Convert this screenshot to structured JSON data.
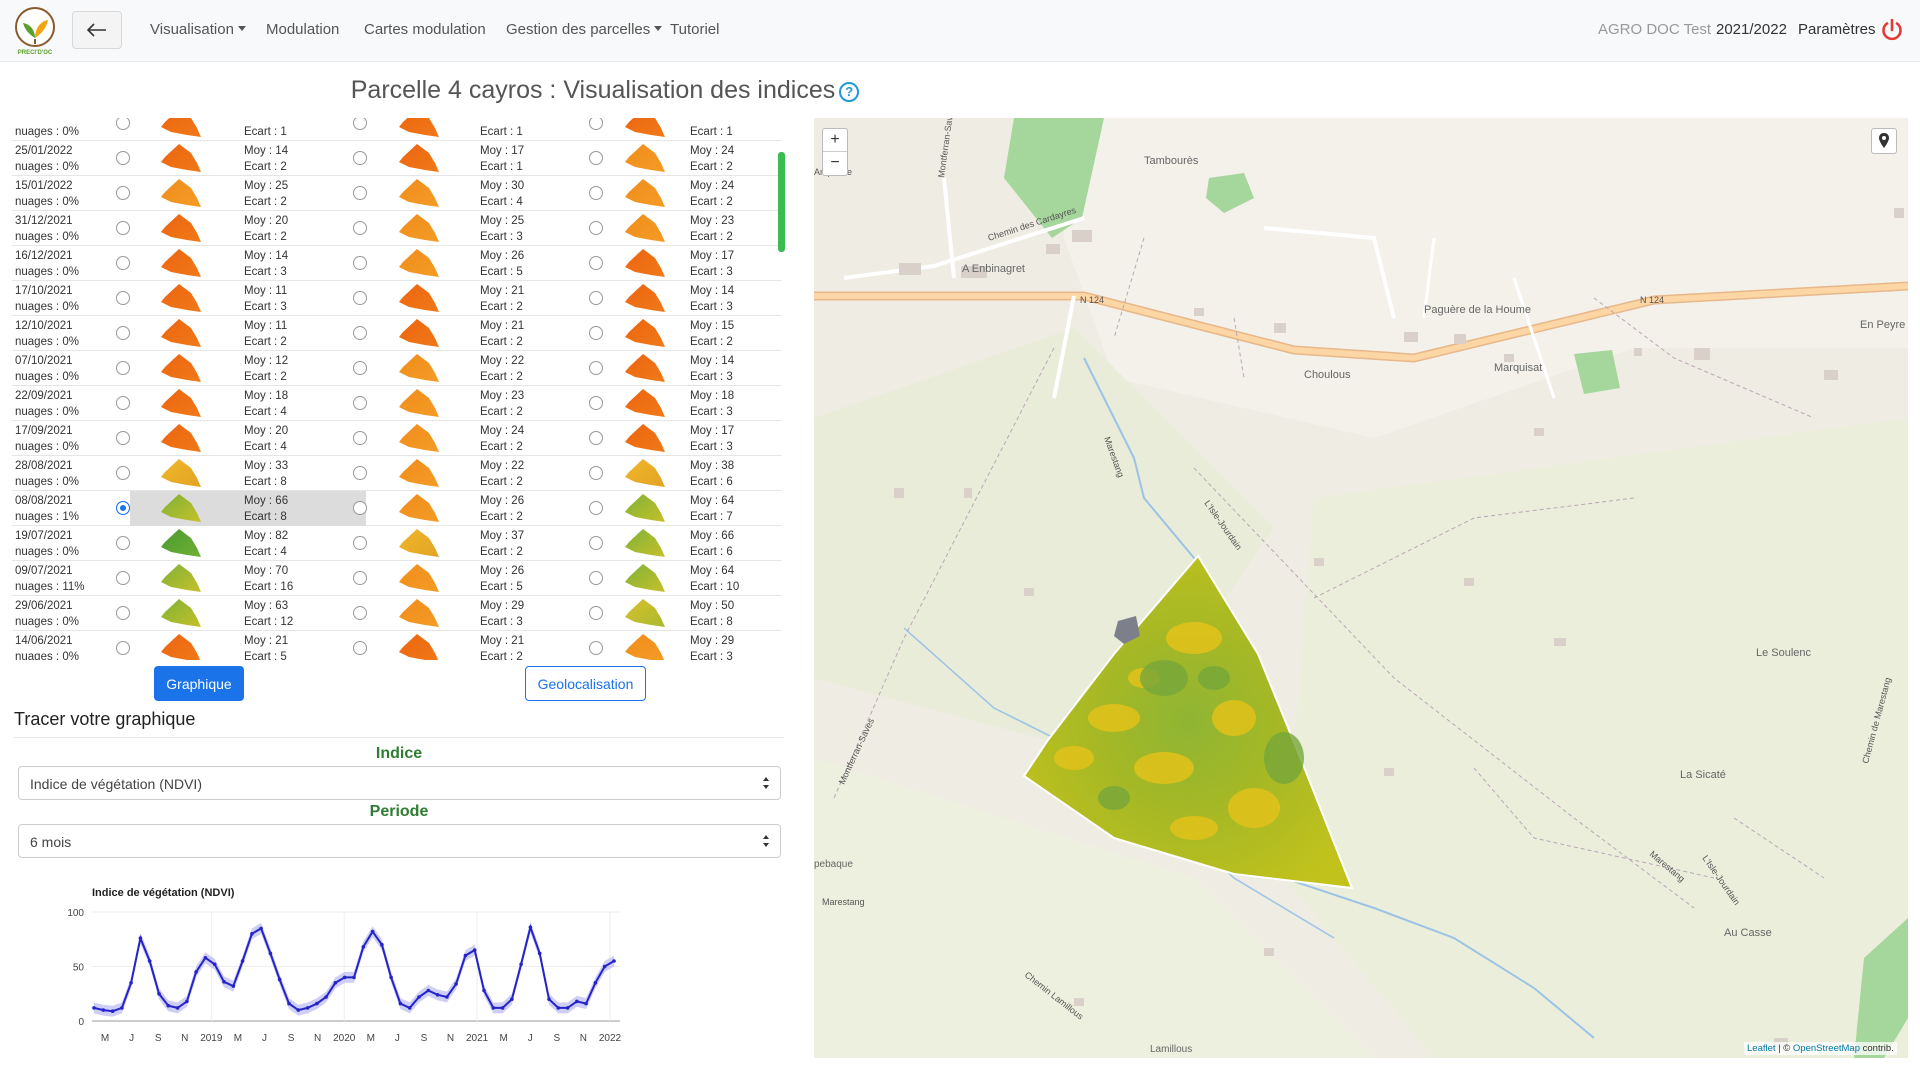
{
  "nav": {
    "logo_text": "PRECI'D'OC",
    "items": [
      "Visualisation",
      "Modulation",
      "Cartes modulation",
      "Gestion des parcelles",
      "Tutoriel"
    ],
    "user": "AGRO DOC Test",
    "season": "2021/2022",
    "settings": "Paramètres"
  },
  "page": {
    "title": "Parcelle 4 cayros : Visualisation des indices"
  },
  "rows": [
    {
      "date": "",
      "clouds": "nuages : 0%",
      "a_moy": "",
      "a_ecart": "Ecart : 1",
      "b_moy": "",
      "b_ecart": "Ecart : 1",
      "c_moy": "",
      "c_ecart": "Ecart : 1"
    },
    {
      "date": "25/01/2022",
      "clouds": "nuages : 0%",
      "a_moy": "Moy : 14",
      "a_ecart": "Ecart : 2",
      "b_moy": "Moy : 17",
      "b_ecart": "Ecart : 1",
      "c_moy": "Moy : 24",
      "c_ecart": "Ecart : 2"
    },
    {
      "date": "15/01/2022",
      "clouds": "nuages : 0%",
      "a_moy": "Moy : 25",
      "a_ecart": "Ecart : 2",
      "b_moy": "Moy : 30",
      "b_ecart": "Ecart : 4",
      "c_moy": "Moy : 24",
      "c_ecart": "Ecart : 2"
    },
    {
      "date": "31/12/2021",
      "clouds": "nuages : 0%",
      "a_moy": "Moy : 20",
      "a_ecart": "Ecart : 2",
      "b_moy": "Moy : 25",
      "b_ecart": "Ecart : 3",
      "c_moy": "Moy : 23",
      "c_ecart": "Ecart : 2"
    },
    {
      "date": "16/12/2021",
      "clouds": "nuages : 0%",
      "a_moy": "Moy : 14",
      "a_ecart": "Ecart : 3",
      "b_moy": "Moy : 26",
      "b_ecart": "Ecart : 5",
      "c_moy": "Moy : 17",
      "c_ecart": "Ecart : 3"
    },
    {
      "date": "17/10/2021",
      "clouds": "nuages : 0%",
      "a_moy": "Moy : 11",
      "a_ecart": "Ecart : 3",
      "b_moy": "Moy : 21",
      "b_ecart": "Ecart : 2",
      "c_moy": "Moy : 14",
      "c_ecart": "Ecart : 3"
    },
    {
      "date": "12/10/2021",
      "clouds": "nuages : 0%",
      "a_moy": "Moy : 11",
      "a_ecart": "Ecart : 2",
      "b_moy": "Moy : 21",
      "b_ecart": "Ecart : 2",
      "c_moy": "Moy : 15",
      "c_ecart": "Ecart : 2"
    },
    {
      "date": "07/10/2021",
      "clouds": "nuages : 0%",
      "a_moy": "Moy : 12",
      "a_ecart": "Ecart : 2",
      "b_moy": "Moy : 22",
      "b_ecart": "Ecart : 2",
      "c_moy": "Moy : 14",
      "c_ecart": "Ecart : 3"
    },
    {
      "date": "22/09/2021",
      "clouds": "nuages : 0%",
      "a_moy": "Moy : 18",
      "a_ecart": "Ecart : 4",
      "b_moy": "Moy : 23",
      "b_ecart": "Ecart : 2",
      "c_moy": "Moy : 18",
      "c_ecart": "Ecart : 3"
    },
    {
      "date": "17/09/2021",
      "clouds": "nuages : 0%",
      "a_moy": "Moy : 20",
      "a_ecart": "Ecart : 4",
      "b_moy": "Moy : 24",
      "b_ecart": "Ecart : 2",
      "c_moy": "Moy : 17",
      "c_ecart": "Ecart : 3"
    },
    {
      "date": "28/08/2021",
      "clouds": "nuages : 0%",
      "a_moy": "Moy : 33",
      "a_ecart": "Ecart : 8",
      "b_moy": "Moy : 22",
      "b_ecart": "Ecart : 2",
      "c_moy": "Moy : 38",
      "c_ecart": "Ecart : 6"
    },
    {
      "date": "08/08/2021",
      "clouds": "nuages : 1%",
      "a_moy": "Moy : 66",
      "a_ecart": "Ecart : 8",
      "b_moy": "Moy : 26",
      "b_ecart": "Ecart : 2",
      "c_moy": "Moy : 64",
      "c_ecart": "Ecart : 7"
    },
    {
      "date": "19/07/2021",
      "clouds": "nuages : 0%",
      "a_moy": "Moy : 82",
      "a_ecart": "Ecart : 4",
      "b_moy": "Moy : 37",
      "b_ecart": "Ecart : 2",
      "c_moy": "Moy : 66",
      "c_ecart": "Ecart : 6"
    },
    {
      "date": "09/07/2021",
      "clouds": "nuages : 11%",
      "a_moy": "Moy : 70",
      "a_ecart": "Ecart : 16",
      "b_moy": "Moy : 26",
      "b_ecart": "Ecart : 5",
      "c_moy": "Moy : 64",
      "c_ecart": "Ecart : 10"
    },
    {
      "date": "29/06/2021",
      "clouds": "nuages : 0%",
      "a_moy": "Moy : 63",
      "a_ecart": "Ecart : 12",
      "b_moy": "Moy : 29",
      "b_ecart": "Ecart : 3",
      "c_moy": "Moy : 50",
      "c_ecart": "Ecart : 8"
    },
    {
      "date": "14/06/2021",
      "clouds": "nuages : 0%",
      "a_moy": "Moy : 21",
      "a_ecart": "Ecart : 5",
      "b_moy": "Moy : 21",
      "b_ecart": "Ecart : 2",
      "c_moy": "Moy : 29",
      "c_ecart": "Ecart : 3"
    }
  ],
  "selected_row": 11,
  "buttons": {
    "graph": "Graphique",
    "geoloc": "Geolocalisation"
  },
  "graph_form": {
    "title": "Tracer votre graphique",
    "index_label": "Indice",
    "index_value": "Indice de végétation (NDVI)",
    "period_label": "Periode",
    "period_value": "6 mois"
  },
  "chart_data": {
    "type": "line",
    "title": "Indice de végétation (NDVI)",
    "ylim": [
      0,
      100
    ],
    "yticks": [
      0,
      50,
      100
    ],
    "xtick_labels": [
      "M",
      "J",
      "S",
      "N",
      "2019",
      "M",
      "J",
      "S",
      "N",
      "2020",
      "M",
      "J",
      "S",
      "N",
      "2021",
      "M",
      "J",
      "S",
      "N",
      "2022"
    ],
    "series": [
      {
        "values": [
          12,
          10,
          9,
          12,
          35,
          76,
          55,
          25,
          14,
          12,
          18,
          45,
          58,
          52,
          36,
          32,
          55,
          80,
          85,
          62,
          38,
          16,
          10,
          12,
          16,
          22,
          35,
          40,
          40,
          68,
          82,
          70,
          40,
          16,
          12,
          22,
          28,
          24,
          22,
          34,
          60,
          65,
          28,
          12,
          12,
          20,
          52,
          86,
          62,
          20,
          12,
          12,
          18,
          16,
          35,
          50,
          55
        ]
      }
    ]
  },
  "map": {
    "labels": [
      "Tambourès",
      "Chemin des Cardayres",
      "A Enbinagret",
      "N 124",
      "N 124",
      "Paguère de la Houme",
      "En Peyre",
      "Marquisat",
      "Choulous",
      "Marestang",
      "L'Isle-Jourdain",
      "Le Soulenc",
      "La Sicaté",
      "Au Casse",
      "Chemin Lamillous",
      "Lamillous",
      "Marestang",
      "Montferran-Saves",
      "Montferran-Saves",
      "Chemin de Marestang",
      "Marestang",
      "L'Isle-Jourdain",
      "pebaque",
      "Ampeche"
    ],
    "attribution_leaflet": "Leaflet",
    "attribution_sep": " | © ",
    "attribution_osm": "OpenStreetMap",
    "attribution_tail": " contrib."
  },
  "colors": {
    "accent": "#1a73e8",
    "label_green": "#2e7d32",
    "power": "#e53935"
  }
}
